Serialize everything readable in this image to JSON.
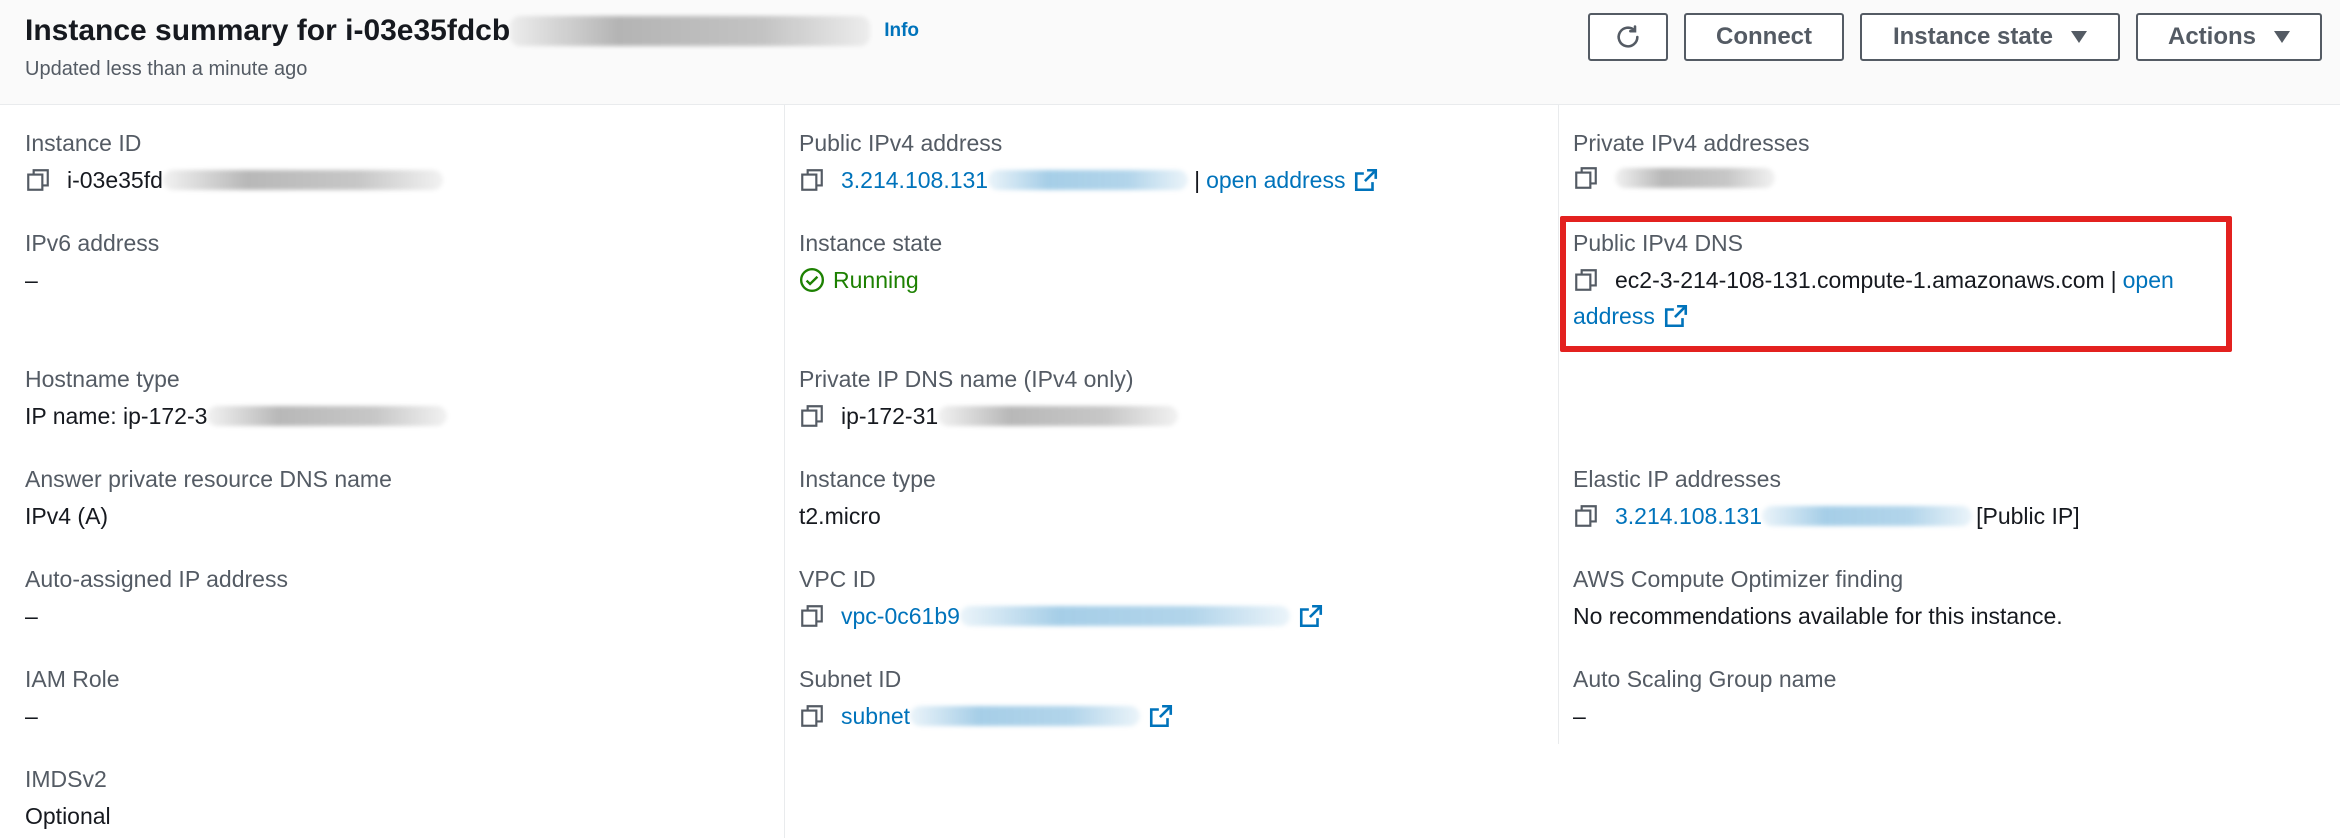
{
  "header": {
    "title": "Instance summary for i-03e35fdcb",
    "info_link": "Info",
    "subtitle": "Updated less than a minute ago",
    "connect_label": "Connect",
    "instance_state_label": "Instance state",
    "actions_label": "Actions"
  },
  "icons": [
    "refresh-icon",
    "caret-down-icon",
    "copy-icon",
    "external-link-icon",
    "check-circle-icon"
  ],
  "col1": {
    "instance_id_label": "Instance ID",
    "instance_id_value": "i-03e35fd",
    "ipv6_label": "IPv6 address",
    "ipv6_value": "–",
    "hostname_type_label": "Hostname type",
    "hostname_type_value": "IP name: ip-172-3",
    "answer_dns_label": "Answer private resource DNS name",
    "answer_dns_value": "IPv4 (A)",
    "auto_ip_label": "Auto-assigned IP address",
    "auto_ip_value": "–",
    "iam_role_label": "IAM Role",
    "iam_role_value": "–",
    "imdsv2_label": "IMDSv2",
    "imdsv2_value": "Optional"
  },
  "col2": {
    "public_ipv4_label": "Public IPv4 address",
    "public_ipv4_value": "3.214.108.131",
    "separator": "|",
    "open_address": "open address",
    "instance_state_label": "Instance state",
    "instance_state_value": "Running",
    "private_dns_label": "Private IP DNS name (IPv4 only)",
    "private_dns_value": "ip-172-31",
    "instance_type_label": "Instance type",
    "instance_type_value": "t2.micro",
    "vpc_label": "VPC ID",
    "vpc_value": "vpc-0c61b9",
    "subnet_label": "Subnet ID",
    "subnet_value": "subnet"
  },
  "col3": {
    "private_ipv4_label": "Private IPv4 addresses",
    "public_dns_label": "Public IPv4 DNS",
    "public_dns_value": "ec2-3-214-108-131.compute-1.amazonaws.com",
    "separator": "|",
    "open_word": "open",
    "address_word": "address",
    "elastic_ip_label": "Elastic IP addresses",
    "elastic_ip_value": "3.214.108.131",
    "elastic_ip_suffix": "[Public IP]",
    "optimizer_label": "AWS Compute Optimizer finding",
    "optimizer_value": "No recommendations available for this instance.",
    "asg_label": "Auto Scaling Group name",
    "asg_value": "–"
  },
  "colors": {
    "link": "#0073bb",
    "running": "#1d8102",
    "highlight": "#e3211f",
    "label": "#545b64"
  }
}
